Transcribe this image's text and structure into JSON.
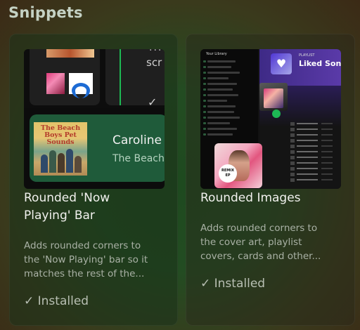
{
  "page": {
    "section_title": "Snippets"
  },
  "cards": [
    {
      "title_line1": "Rounded 'Now",
      "title_line2": "Playing' Bar",
      "desc_line1": "Adds rounded corners to",
      "desc_line2": "the 'Now Playing' bar so it",
      "desc_line3": "matches the rest of the...",
      "status": "✓ Installed",
      "preview": {
        "scr_text": "scr",
        "cover_text": "The Beach Boys Pet Sounds",
        "song": "Caroline",
        "artist": "The Beach"
      }
    },
    {
      "title_line1": "Rounded Images",
      "desc_line1": "Adds rounded corners to",
      "desc_line2": "the cover art, playlist",
      "desc_line3": "covers, cards and other...",
      "status": "✓ Installed",
      "preview": {
        "sidebar_header": "Your Library",
        "playlist_label": "PLAYLIST",
        "playlist_title": "Liked Songs",
        "remix_label": "REMIX EP"
      }
    }
  ],
  "colors": {
    "spotify_green": "#1db954",
    "now_playing_bg": "#1f5b3a"
  }
}
